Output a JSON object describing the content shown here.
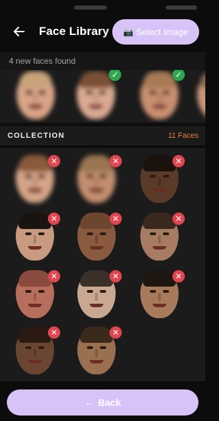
{
  "header": {
    "title": "Face Library",
    "select_button_icon": "camera-icon",
    "select_button_icon_glyph": "📷",
    "select_button_label": "Select Image",
    "back_icon": "back-arrow-icon"
  },
  "new_faces": {
    "count_label": "4 new faces found",
    "faces": [
      {
        "name": "face-woman-blonde",
        "skin": "#d9a488",
        "hair": "#c9a27a",
        "blurred": true,
        "checked": false
      },
      {
        "name": "face-boy",
        "skin": "#dba992",
        "hair": "#7a5036",
        "blurred": true,
        "checked": true
      },
      {
        "name": "face-man-smiling",
        "skin": "#c99070",
        "hair": "#a87a55",
        "blurred": true,
        "checked": true
      },
      {
        "name": "face-partial",
        "skin": "#c89678",
        "hair": "#8a6a4e",
        "blurred": true,
        "checked": false
      }
    ]
  },
  "collection": {
    "title": "COLLECTION",
    "count": "11 Faces",
    "faces": [
      {
        "name": "face-boy",
        "skin": "#d4a488",
        "hair": "#8a5a3c",
        "blurred": true
      },
      {
        "name": "face-man-smiling",
        "skin": "#c28e6e",
        "hair": "#9a7450",
        "blurred": true
      },
      {
        "name": "face-dark-skin-man",
        "skin": "#5a3a28",
        "hair": "#1a120c",
        "blurred": false
      },
      {
        "name": "face-man-dark-hair",
        "skin": "#c89a80",
        "hair": "#1a1410",
        "blurred": false
      },
      {
        "name": "face-bald-man",
        "skin": "#8a5a3e",
        "hair": "#6e4630",
        "blurred": false
      },
      {
        "name": "face-man-beard",
        "skin": "#a87c62",
        "hair": "#3a2a1e",
        "blurred": false
      },
      {
        "name": "face-scarred-man",
        "skin": "#b86e5c",
        "hair": "#8a4a3e",
        "blurred": false
      },
      {
        "name": "face-pale-man",
        "skin": "#c8a890",
        "hair": "#3a3028",
        "blurred": false
      },
      {
        "name": "face-man-slick-hair",
        "skin": "#a87a5c",
        "hair": "#1e1610",
        "blurred": false
      },
      {
        "name": "face-older-man",
        "skin": "#6a4632",
        "hair": "#2a1a12",
        "blurred": false
      },
      {
        "name": "face-bearded-warrior",
        "skin": "#9a7050",
        "hair": "#3a2a1c",
        "blurred": false
      }
    ]
  },
  "footer": {
    "back_button_label": "Back",
    "back_button_arrow": "←"
  },
  "colors": {
    "accent": "#d7c3f7",
    "count_orange": "#f07b3c",
    "check_green": "#2ea84e",
    "remove_red": "#e24550",
    "background": "#0c0c0c",
    "panel": "#1b1b1b"
  }
}
